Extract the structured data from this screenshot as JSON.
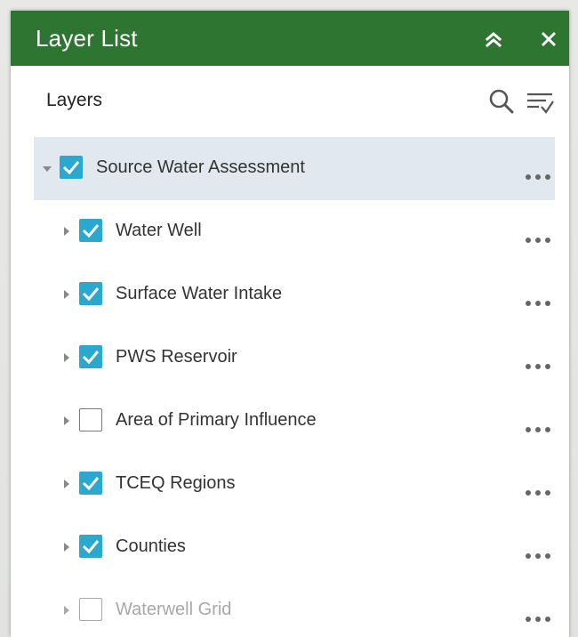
{
  "panel": {
    "title": "Layer List",
    "header_color": "#2e7532"
  },
  "toolbar": {
    "layers_label": "Layers"
  },
  "layers": [
    {
      "label": "Source Water Assessment",
      "checked": true,
      "level": 0,
      "expanded": true,
      "dimmed": false
    },
    {
      "label": "Water Well",
      "checked": true,
      "level": 1,
      "expanded": false,
      "dimmed": false
    },
    {
      "label": "Surface Water Intake",
      "checked": true,
      "level": 1,
      "expanded": false,
      "dimmed": false
    },
    {
      "label": "PWS Reservoir",
      "checked": true,
      "level": 1,
      "expanded": false,
      "dimmed": false
    },
    {
      "label": "Area of Primary Influence",
      "checked": false,
      "level": 1,
      "expanded": false,
      "dimmed": false
    },
    {
      "label": "TCEQ Regions",
      "checked": true,
      "level": 1,
      "expanded": false,
      "dimmed": false
    },
    {
      "label": "Counties",
      "checked": true,
      "level": 1,
      "expanded": false,
      "dimmed": false
    },
    {
      "label": "Waterwell Grid",
      "checked": false,
      "level": 1,
      "expanded": false,
      "dimmed": true
    }
  ],
  "colors": {
    "checkbox_checked": "#2aa8d0",
    "selected_row": "#e1e8ef",
    "dimmed_text": "#a8a8a8"
  },
  "icons": {
    "collapse": "double-chevron-up-icon",
    "close": "close-icon",
    "search": "search-icon",
    "filter": "filter-list-icon",
    "more": "more-options-icon",
    "expander_open": "caret-down-icon",
    "expander_closed": "caret-right-icon",
    "checkbox": "checkmark-icon"
  }
}
